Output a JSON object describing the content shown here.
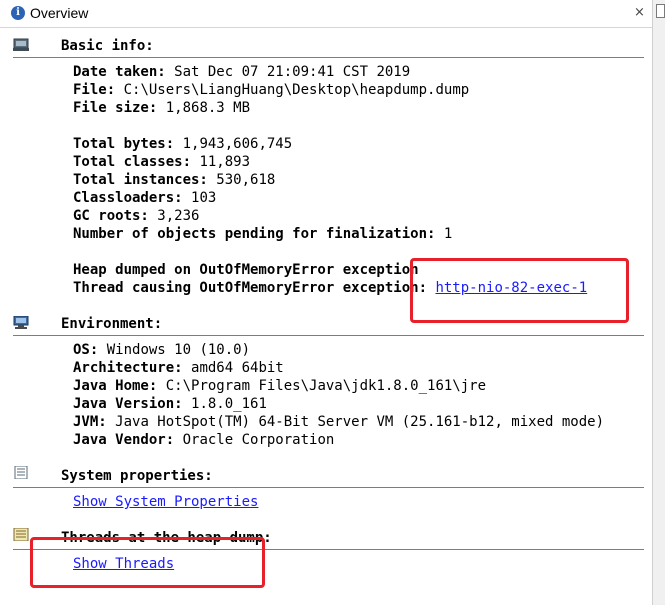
{
  "tab": {
    "title": "Overview",
    "close": "×"
  },
  "sections": {
    "basic": {
      "title": "Basic info:"
    },
    "environment": {
      "title": "Environment:"
    },
    "system": {
      "title": "System properties:",
      "link": "Show System Properties"
    },
    "threads": {
      "title": "Threads at the heap dump:",
      "link": "Show Threads"
    }
  },
  "basic": {
    "date_label": "Date taken:",
    "date_value": "Sat Dec 07 21:09:41 CST 2019",
    "file_label": "File:",
    "file_value": "C:\\Users\\LiangHuang\\Desktop\\heapdump.dump",
    "size_label": "File size:",
    "size_value": "1,868.3 MB",
    "bytes_label": "Total bytes:",
    "bytes_value": "1,943,606,745",
    "classes_label": "Total classes:",
    "classes_value": "11,893",
    "instances_label": "Total instances:",
    "instances_value": "530,618",
    "loaders_label": "Classloaders:",
    "loaders_value": "103",
    "gc_label": "GC roots:",
    "gc_value": "3,236",
    "pending_label": "Number of objects pending for finalization:",
    "pending_value": "1",
    "oom_line": "Heap dumped on OutOfMemoryError exception",
    "thread_label": "Thread causing OutOfMemoryError exception:",
    "thread_link": "http-nio-82-exec-1"
  },
  "env": {
    "os_label": "OS:",
    "os_value": "Windows 10 (10.0)",
    "arch_label": "Architecture:",
    "arch_value": "amd64 64bit",
    "home_label": "Java Home:",
    "home_value": "C:\\Program Files\\Java\\jdk1.8.0_161\\jre",
    "ver_label": "Java Version:",
    "ver_value": "1.8.0_161",
    "jvm_label": "JVM:",
    "jvm_value": "Java HotSpot(TM) 64-Bit Server VM (25.161-b12, mixed mode)",
    "vendor_label": "Java Vendor:",
    "vendor_value": "Oracle Corporation"
  },
  "colors": {
    "link": "#1a1aff",
    "highlight": "#e8202a",
    "rule": "#7d7d7d"
  }
}
